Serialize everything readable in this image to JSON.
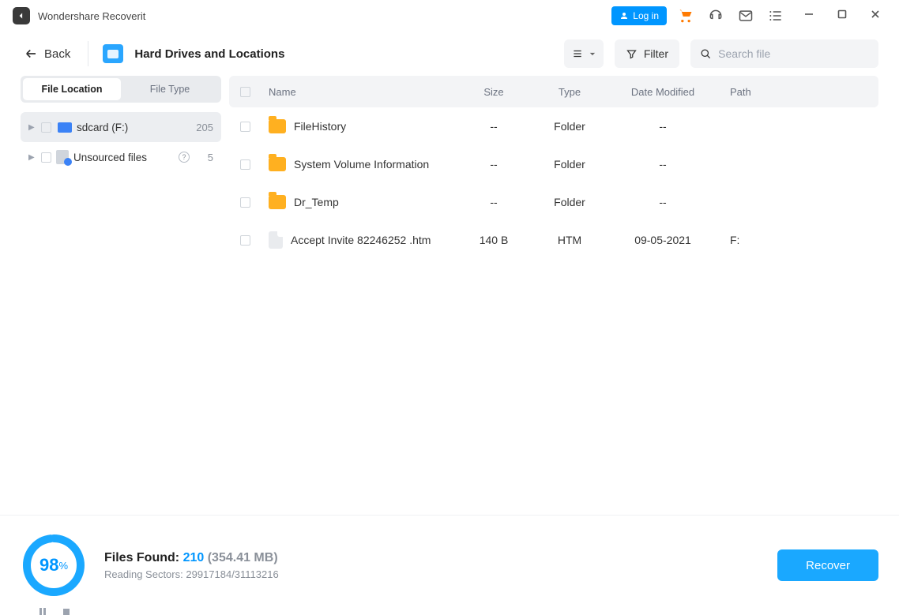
{
  "titlebar": {
    "app_name": "Wondershare Recoverit",
    "login_label": "Log in"
  },
  "toolbar": {
    "back_label": "Back",
    "location_title": "Hard Drives and Locations",
    "filter_label": "Filter",
    "search_placeholder": "Search file"
  },
  "sidebar": {
    "tab_location": "File Location",
    "tab_type": "File Type",
    "items": [
      {
        "label": "sdcard (F:)",
        "count": "205"
      },
      {
        "label": "Unsourced files",
        "count": "5"
      }
    ]
  },
  "table": {
    "headers": {
      "name": "Name",
      "size": "Size",
      "type": "Type",
      "date": "Date Modified",
      "path": "Path"
    },
    "rows": [
      {
        "name": "FileHistory",
        "size": "--",
        "type": "Folder",
        "date": "--",
        "path": "",
        "kind": "folder"
      },
      {
        "name": "System Volume Information",
        "size": "--",
        "type": "Folder",
        "date": "--",
        "path": "",
        "kind": "folder"
      },
      {
        "name": "Dr_Temp",
        "size": "--",
        "type": "Folder",
        "date": "--",
        "path": "",
        "kind": "folder"
      },
      {
        "name": "Accept Invite 82246252 .htm",
        "size": "140 B",
        "type": "HTM",
        "date": "09-05-2021",
        "path": "F:",
        "kind": "file"
      }
    ]
  },
  "footer": {
    "percent": "98",
    "percent_unit": "%",
    "files_found_label": "Files Found:",
    "files_found_count": "210",
    "files_found_size": "(354.41 MB)",
    "sectors_label": "Reading Sectors:",
    "sectors_value": "29917184/31113216",
    "recover_label": "Recover"
  }
}
